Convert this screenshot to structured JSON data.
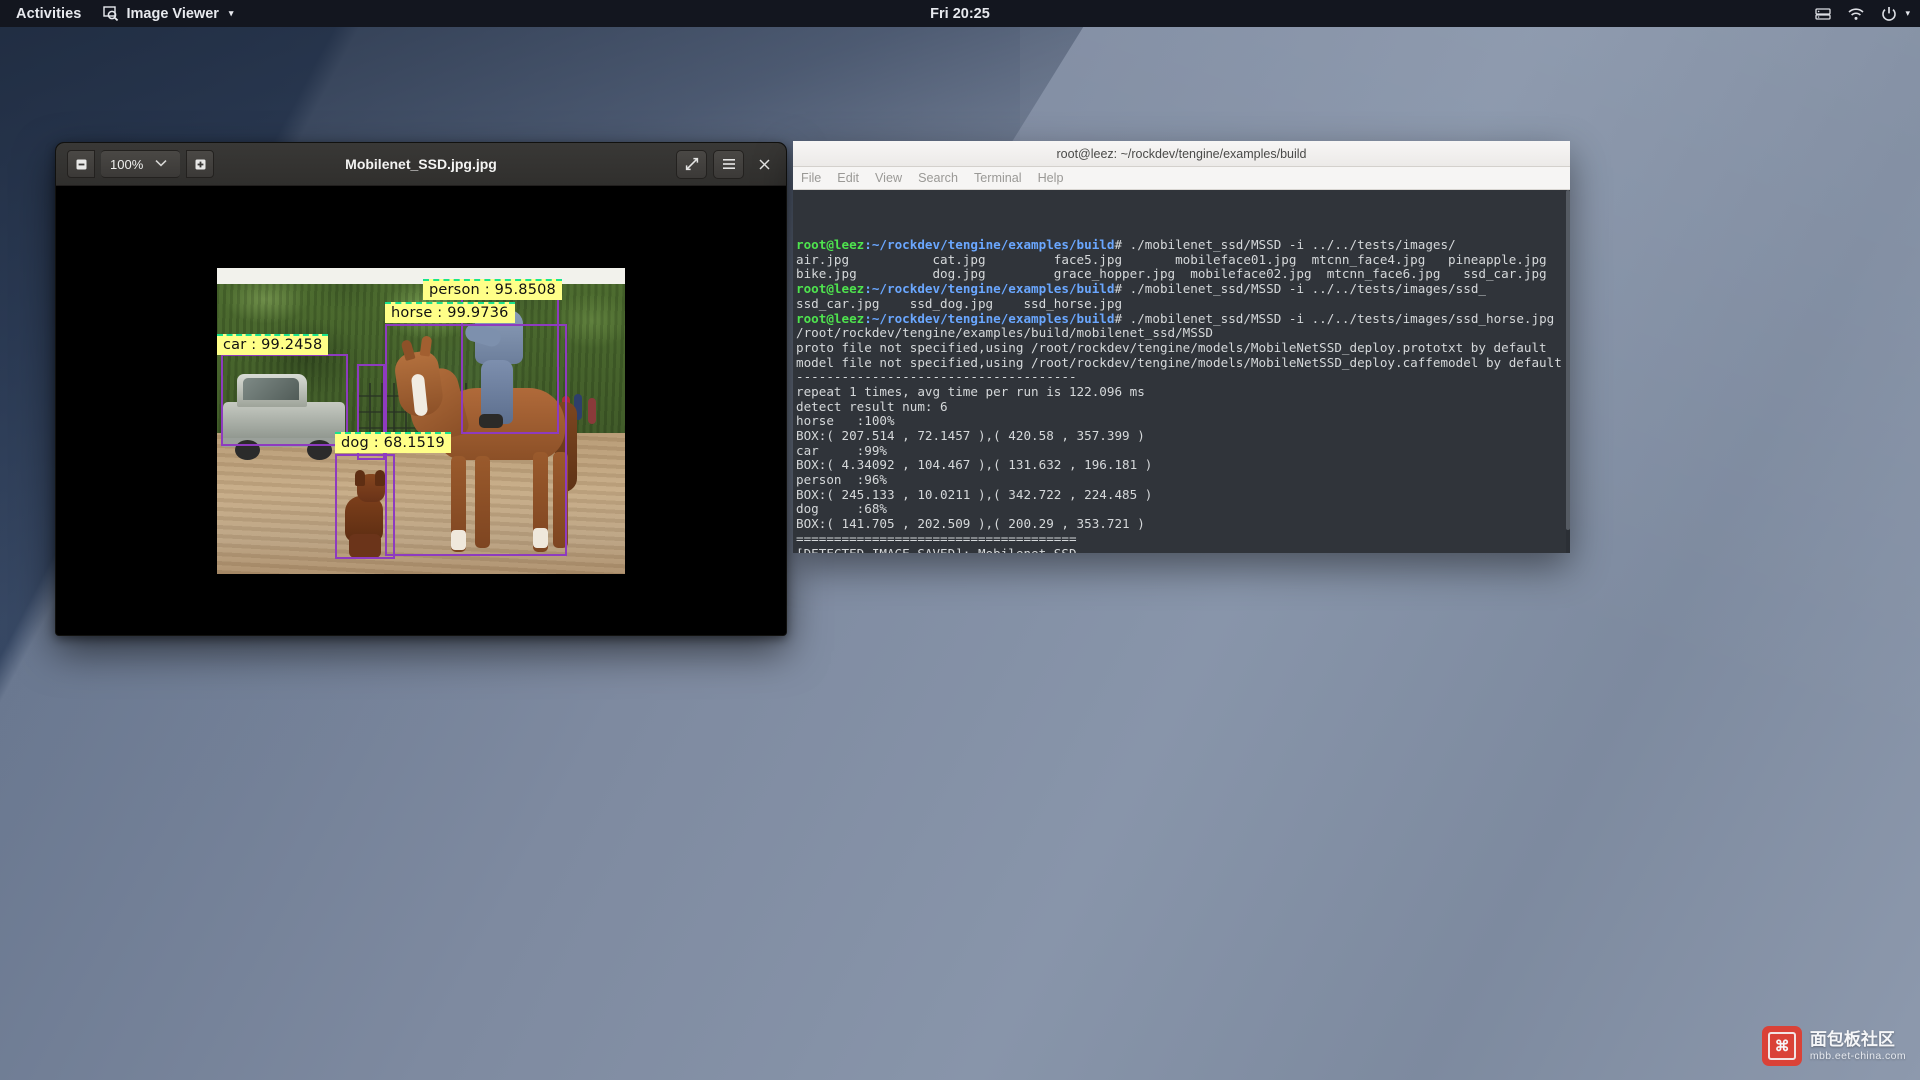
{
  "topbar": {
    "activities": "Activities",
    "app_name": "Image Viewer",
    "app_icon": "image-viewer-icon",
    "caret": "▾",
    "clock": "Fri 20:25",
    "tray": {
      "network_icon": "network-icon",
      "wifi_icon": "wifi-icon",
      "power_icon": "power-icon",
      "menu_caret": "▾"
    }
  },
  "viewer": {
    "title": "Mobilenet_SSD.jpg.jpg",
    "zoom_level": "100%",
    "zoom_out_icon": "zoom-out-icon",
    "zoom_in_icon": "zoom-in-icon",
    "zoom_dropdown_icon": "chevron-down-icon",
    "fullscreen_icon": "fullscreen-icon",
    "menu_icon": "hamburger-menu-icon",
    "close_icon": "close-icon",
    "close_label": "×",
    "menu_label": "☰",
    "fullscreen_label": "⤡",
    "zoom_out_label": "−",
    "zoom_in_label": "+",
    "detections": [
      {
        "label": "person : 95.8508",
        "class": "person",
        "score": "95.8508"
      },
      {
        "label": "horse : 99.9736",
        "class": "horse",
        "score": "99.9736"
      },
      {
        "label": "car : 99.2458",
        "class": "car",
        "score": "99.2458"
      },
      {
        "label": "dog : 68.1519",
        "class": "dog",
        "score": "68.1519"
      }
    ]
  },
  "terminal": {
    "window_title": "root@leez: ~/rockdev/tengine/examples/build",
    "menu": [
      "File",
      "Edit",
      "View",
      "Search",
      "Terminal",
      "Help"
    ],
    "prompt_user": "root@leez",
    "prompt_path": ":~/rockdev/tengine/examples/build",
    "prompt_sym": "# ",
    "lines": [
      {
        "type": "prompt",
        "cmd": "./mobilenet_ssd/MSSD -i ../../tests/images/"
      },
      {
        "type": "out",
        "text": "air.jpg           cat.jpg         face5.jpg       mobileface01.jpg  mtcnn_face4.jpg   pineapple.jpg"
      },
      {
        "type": "out",
        "text": "bike.jpg          dog.jpg         grace_hopper.jpg  mobileface02.jpg  mtcnn_face6.jpg   ssd_car.jpg"
      },
      {
        "type": "prompt",
        "cmd": "./mobilenet_ssd/MSSD -i ../../tests/images/ssd_"
      },
      {
        "type": "out",
        "text": "ssd_car.jpg    ssd_dog.jpg    ssd_horse.jpg"
      },
      {
        "type": "prompt",
        "cmd": "./mobilenet_ssd/MSSD -i ../../tests/images/ssd_horse.jpg"
      },
      {
        "type": "out",
        "text": "/root/rockdev/tengine/examples/build/mobilenet_ssd/MSSD"
      },
      {
        "type": "out",
        "text": "proto file not specified,using /root/rockdev/tengine/models/MobileNetSSD_deploy.prototxt by default"
      },
      {
        "type": "out",
        "text": "model file not specified,using /root/rockdev/tengine/models/MobileNetSSD_deploy.caffemodel by default"
      },
      {
        "type": "out",
        "text": "-------------------------------------"
      },
      {
        "type": "out",
        "text": "repeat 1 times, avg time per run is 122.096 ms"
      },
      {
        "type": "out",
        "text": "detect result num: 6"
      },
      {
        "type": "out",
        "text": "horse   :100%"
      },
      {
        "type": "out",
        "text": "BOX:( 207.514 , 72.1457 ),( 420.58 , 357.399 )"
      },
      {
        "type": "out",
        "text": "car     :99%"
      },
      {
        "type": "out",
        "text": "BOX:( 4.34092 , 104.467 ),( 131.632 , 196.181 )"
      },
      {
        "type": "out",
        "text": "person  :96%"
      },
      {
        "type": "out",
        "text": "BOX:( 245.133 , 10.0211 ),( 342.722 , 224.485 )"
      },
      {
        "type": "out",
        "text": "dog     :68%"
      },
      {
        "type": "out",
        "text": "BOX:( 141.705 , 202.509 ),( 200.29 , 353.721 )"
      },
      {
        "type": "out",
        "text": "====================================="
      },
      {
        "type": "out",
        "text": "[DETECTED IMAGE SAVED]: Mobilenet_SSD"
      },
      {
        "type": "out",
        "text": "====================================="
      },
      {
        "type": "prompt_cursor",
        "cmd": ""
      }
    ]
  },
  "watermark": {
    "logo_text": "⌘",
    "title_cn": "面包板社区",
    "title_en": "mbb.eet-china.com"
  },
  "colors": {
    "topbar_bg": "#13161f",
    "label_bg": "#ffff88",
    "box_purple": "#8e3bbf",
    "box_green": "#19e38c",
    "terminal_bg": "#30343a",
    "prompt_green": "#4ee44e",
    "prompt_blue": "#6aa7ff"
  }
}
